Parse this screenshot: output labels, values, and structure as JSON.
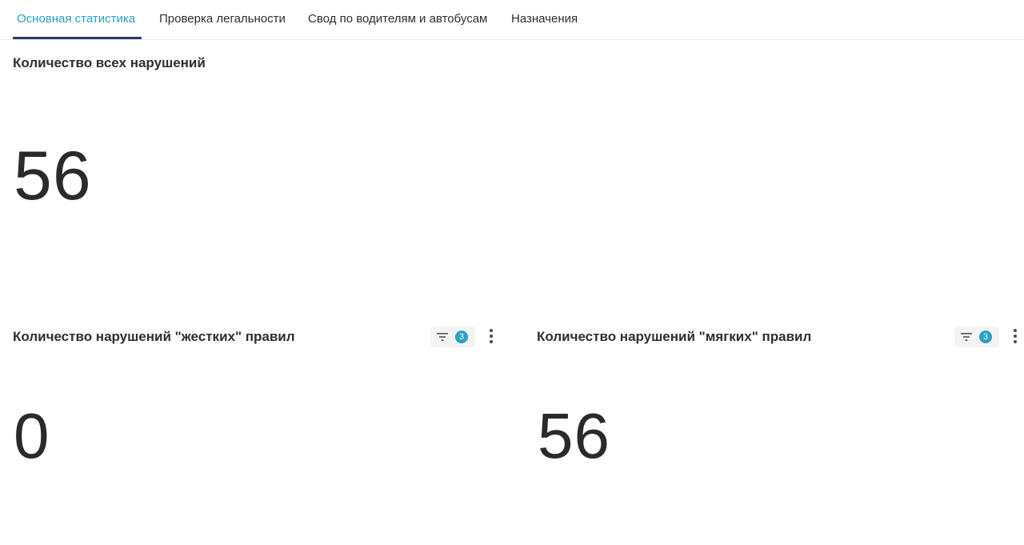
{
  "tabs": [
    {
      "label": "Основная статистика",
      "active": true
    },
    {
      "label": "Проверка легальности",
      "active": false
    },
    {
      "label": "Свод по водителям и автобусам",
      "active": false
    },
    {
      "label": "Назначения",
      "active": false
    }
  ],
  "cards": {
    "total": {
      "title": "Количество всех нарушений",
      "value": "56"
    },
    "hard": {
      "title": "Количество нарушений \"жестких\" правил",
      "value": "0",
      "filter_count": "3"
    },
    "soft": {
      "title": "Количество нарушений \"мягких\" правил",
      "value": "56",
      "filter_count": "3"
    }
  },
  "colors": {
    "accent": "#2a9fc4",
    "tab_underline": "#2d3a66",
    "badge": "#2aa1c0"
  },
  "icons": {
    "filter": "filter-icon",
    "more": "more-vertical-icon"
  }
}
